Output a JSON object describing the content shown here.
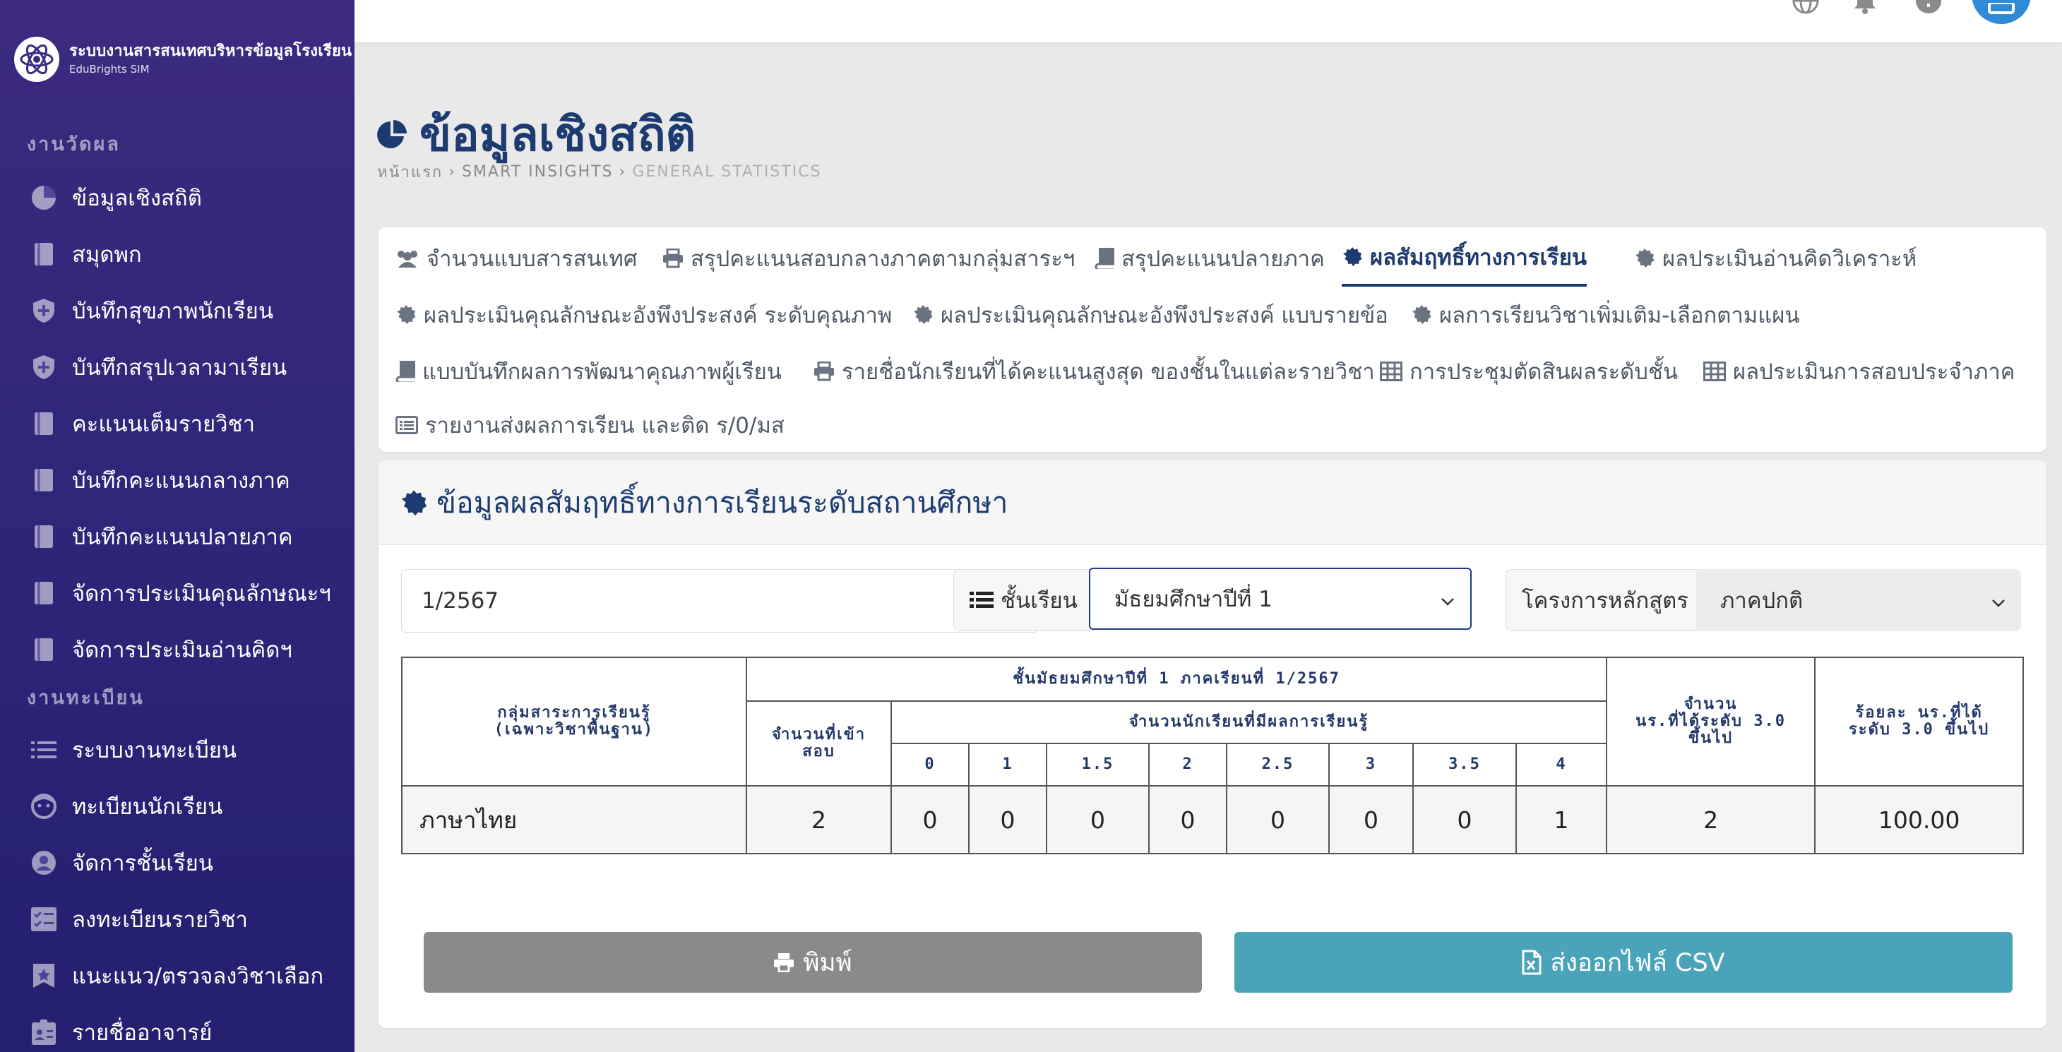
{
  "brand": {
    "title": "ระบบงานสารสนเทศบริหารข้อมูลโรงเรียน",
    "subtitle": "EduBrights SIM"
  },
  "sidebar": {
    "section_eval": "งานวัดผล",
    "eval_items": [
      {
        "label": "ข้อมูลเชิงสถิติ",
        "icon": "pie-chart-icon"
      },
      {
        "label": "สมุดพก",
        "icon": "book-icon"
      },
      {
        "label": "บันทึกสุขภาพนักเรียน",
        "icon": "health-shield-icon"
      },
      {
        "label": "บันทึกสรุปเวลามาเรียน",
        "icon": "health-shield-icon"
      },
      {
        "label": "คะแนนเต็มรายวิชา",
        "icon": "book-icon"
      },
      {
        "label": "บันทึกคะแนนกลางภาค",
        "icon": "book-icon"
      },
      {
        "label": "บันทึกคะแนนปลายภาค",
        "icon": "book-icon"
      },
      {
        "label": "จัดการประเมินคุณลักษณะฯ",
        "icon": "book-icon"
      },
      {
        "label": "จัดการประเมินอ่านคิดฯ",
        "icon": "book-icon"
      }
    ],
    "section_reg": "งานทะเบียน",
    "reg_items": [
      {
        "label": "ระบบงานทะเบียน",
        "icon": "list-icon"
      },
      {
        "label": "ทะเบียนนักเรียน",
        "icon": "student-face-icon"
      },
      {
        "label": "จัดการชั้นเรียน",
        "icon": "user-circle-icon"
      },
      {
        "label": "ลงทะเบียนรายวิชา",
        "icon": "checklist-icon"
      },
      {
        "label": "แนะแนว/ตรวจลงวิชาเลือก",
        "icon": "star-badge-icon"
      },
      {
        "label": "รายชื่ออาจารย์",
        "icon": "id-card-icon"
      }
    ]
  },
  "page": {
    "title": "ข้อมูลเชิงสถิติ",
    "breadcrumb": [
      "หน้าแรก",
      "SMART INSIGHTS",
      "GENERAL STATISTICS"
    ]
  },
  "tabs": [
    {
      "label": "จำนวนแบบสารสนเทศ",
      "icon": "users-icon"
    },
    {
      "label": "สรุปคะแนนสอบกลางภาคตามกลุ่มสาระฯ",
      "icon": "printer-icon"
    },
    {
      "label": "สรุปคะแนนปลายภาค",
      "icon": "book-icon"
    },
    {
      "label": "ผลสัมฤทธิ์ทางการเรียน",
      "icon": "certificate-icon",
      "active": true
    },
    {
      "label": "ผลประเมินอ่านคิดวิเคราะห์",
      "icon": "certificate-icon"
    },
    {
      "label": "ผลประเมินคุณลักษณะอังพึงประสงค์ ระดับคุณภาพ",
      "icon": "certificate-icon"
    },
    {
      "label": "ผลประเมินคุณลักษณะอังพึงประสงค์ แบบรายข้อ",
      "icon": "certificate-icon"
    },
    {
      "label": "ผลการเรียนวิชาเพิ่มเติม-เลือกตามแผน",
      "icon": "certificate-icon"
    },
    {
      "label": "แบบบันทึกผลการพัฒนาคุณภาพผู้เรียน",
      "icon": "book-icon"
    },
    {
      "label": "รายชื่อนักเรียนที่ได้คะแนนสูงสุด ของชั้นในแต่ละรายวิชา",
      "icon": "printer-icon"
    },
    {
      "label": "การประชุมตัดสินผลระดับชั้น",
      "icon": "table-icon"
    },
    {
      "label": "ผลประเมินการสอบประจำภาค",
      "icon": "table-icon"
    },
    {
      "label": "รายงานส่งผลการเรียน และติด ร/0/มส",
      "icon": "list-alt-icon"
    }
  ],
  "card": {
    "title": "ข้อมูลผลสัมฤทธิ์ทางการเรียนระดับสถานศึกษา"
  },
  "filters": {
    "term_value": "1/2567",
    "class_label": "ชั้นเรียน",
    "class_value": "มัธยมศึกษาปีที่ 1",
    "program_label": "โครงการหลักสูตร",
    "program_value": "ภาคปกติ"
  },
  "table": {
    "group_header_l1": "กลุ่มสาระการเรียนรู้",
    "group_header_l2": "(เฉพาะวิชาพื้นฐาน)",
    "level_header": "ชั้นมัธยมศึกษาปีที่ 1  ภาคเรียนที่ 1/2567",
    "tested_header_l1": "จำนวนที่เข้า",
    "tested_header_l2": "สอบ",
    "grades_header": "จำนวนนักเรียนที่มีผลการเรียนรู้",
    "grades": [
      "0",
      "1",
      "1.5",
      "2",
      "2.5",
      "3",
      "3.5",
      "4"
    ],
    "count3_header_l1": "จำนวน",
    "count3_header_l2": "นร.ที่ได้ระดับ 3.0",
    "count3_header_l3": "ขึ้นไป",
    "pct_header_l1": "ร้อยละ นร.ที่ได้",
    "pct_header_l2": "ระดับ 3.0 ขึ้นไป",
    "rows": [
      {
        "subject": "ภาษาไทย",
        "tested": "2",
        "g0": "0",
        "g1": "0",
        "g15": "0",
        "g2": "0",
        "g25": "0",
        "g3": "0",
        "g35": "0",
        "g4": "1",
        "count3": "2",
        "pct3": "100.00"
      }
    ]
  },
  "buttons": {
    "print": "พิมพ์",
    "csv": "ส่งออกไฟล์ CSV"
  },
  "colors": {
    "sidebar": "#2f2679",
    "accent": "#1d3b70",
    "print_button": "#8a8a8a",
    "csv_button": "#4aa3b8",
    "user_button": "#2f8bd8"
  }
}
